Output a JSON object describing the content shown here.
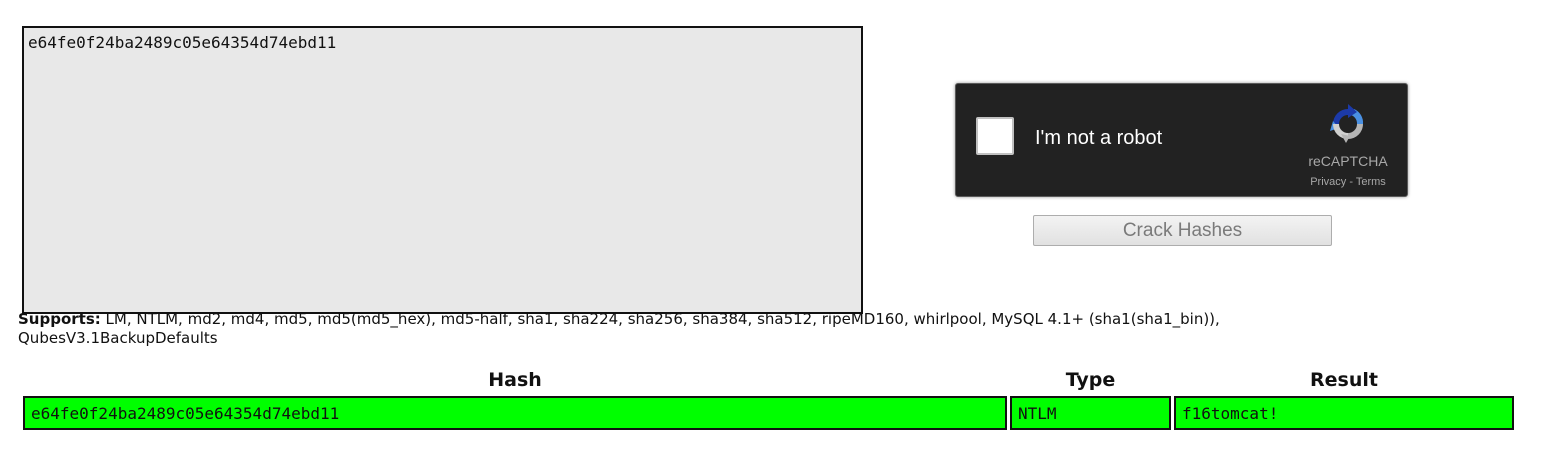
{
  "hash_input": {
    "value": "e64fe0f24ba2489c05e64354d74ebd11"
  },
  "captcha": {
    "label": "I'm not a robot",
    "brand": "reCAPTCHA",
    "privacy_link": "Privacy",
    "separator": " - ",
    "terms_link": "Terms",
    "logo_icon": "recaptcha-logo-icon"
  },
  "crack_button": {
    "label": "Crack Hashes"
  },
  "supports": {
    "label": "Supports:",
    "text": " LM, NTLM, md2, md4, md5, md5(md5_hex), md5-half, sha1, sha224, sha256, sha384, sha512, ripeMD160, whirlpool, MySQL 4.1+ (sha1(sha1_bin)), QubesV3.1BackupDefaults"
  },
  "results": {
    "headers": [
      "Hash",
      "Type",
      "Result"
    ],
    "rows": [
      {
        "hash": "e64fe0f24ba2489c05e64354d74ebd11",
        "type": "NTLM",
        "result": "f16tomcat!",
        "status_color": "#00ff00"
      }
    ]
  },
  "colors": {
    "captcha_background": "#222222",
    "success_row": "#00ff00",
    "textarea_background": "#e8e8e8"
  }
}
